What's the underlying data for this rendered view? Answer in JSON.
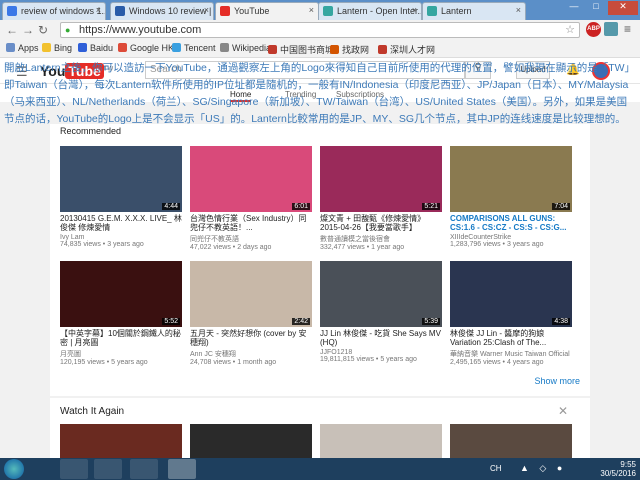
{
  "browser": {
    "tabs": [
      {
        "title": "review of windows 1...",
        "color": "#3b78e7"
      },
      {
        "title": "Windows 10 review |",
        "color": "#2a5ca8"
      },
      {
        "title": "YouTube",
        "color": "#e52d27"
      },
      {
        "title": "Lantern - Open Inter...",
        "color": "#35a6a0"
      },
      {
        "title": "Lantern",
        "color": "#35a6a0"
      }
    ],
    "url": "https://www.youtube.com",
    "abp_label": "ABP",
    "bookmarks": [
      {
        "label": "Apps",
        "color": "#6a8ec8"
      },
      {
        "label": "Bing",
        "color": "#f2c12e"
      },
      {
        "label": "Baidu",
        "color": "#2f5fd8"
      },
      {
        "label": "Google HK",
        "color": "#dd4b39"
      },
      {
        "label": "Tencent",
        "color": "#3aa0e0"
      },
      {
        "label": "Wikipedia",
        "color": "#888888"
      },
      {
        "label": "中国图书商城",
        "color": "#c0392b"
      },
      {
        "label": "找政网",
        "color": "#d35400"
      },
      {
        "label": "深圳人才网",
        "color": "#c0392b"
      }
    ]
  },
  "youtube": {
    "logo_left": "You",
    "logo_right": "Tube",
    "logo_region": "TW",
    "search_placeholder": "Search",
    "upload_label": "Upload",
    "nav": [
      "Home",
      "Trending",
      "Subscriptions"
    ],
    "section_title": "Recommended",
    "show_more": "Show more",
    "watch_it_again": "Watch It Again",
    "videos": [
      {
        "title": "20130415 G.E.M. X.X.X. LIVE_ 林俊傑 修煉愛情",
        "channel": "Ivy Lam",
        "views": "74,835 views",
        "age": "3 years ago",
        "duration": "4:44",
        "bg": "#3a4f6a",
        "linked": false
      },
      {
        "title": "台灣色情行業（Sex Industry）同兜仔不教英語！...",
        "channel": "同兜仔不教英語",
        "views": "47,022 views",
        "age": "2 days ago",
        "duration": "6:01",
        "bg": "#d94a7a",
        "linked": false
      },
      {
        "title": "燦文青 + 田馥甄《修煉愛情》2015-04-26【我要當歌手】",
        "channel": "數普通讀模之當後宿會",
        "views": "332,477 views",
        "age": "1 year ago",
        "duration": "5:21",
        "bg": "#9a2a5a",
        "linked": false
      },
      {
        "title": "COMPARISONS ALL GUNS: CS:1.6 - CS:CZ - CS:S - CS:G...",
        "channel": "XIIIdeCounterStrike",
        "views": "1,283,796 views",
        "age": "3 years ago",
        "duration": "7:04",
        "bg": "#8a7a50",
        "linked": true
      },
      {
        "title": "【中英字幕】10個關於鋼鐵人的秘密 | 月亮圖",
        "channel": "月亮圖",
        "views": "120,195 views",
        "age": "5 years ago",
        "duration": "5:52",
        "bg": "#3a1010",
        "linked": false
      },
      {
        "title": "五月天 - 突然好想你 (cover by 安穗翔)",
        "channel": "Ann JC 安穗翔",
        "views": "24,708 views",
        "age": "1 month ago",
        "duration": "2:42",
        "bg": "#c8b8a8",
        "linked": false
      },
      {
        "title": "JJ Lin 林俊傑 - 吃貨 She Says MV (HQ)",
        "channel": "JJFO1218",
        "views": "19,811,815 views",
        "age": "5 years ago",
        "duration": "5:39",
        "bg": "#4a5058",
        "linked": false
      },
      {
        "title": "林俊傑 JJ Lin - 醬摩的狗娘 Variation 25:Clash of The...",
        "channel": "華納音樂 Warner Music Taiwan Official",
        "views": "2,495,165 views",
        "age": "4 years ago",
        "duration": "4:38",
        "bg": "#2a3550",
        "linked": false
      }
    ]
  },
  "overlay_text": "開啟Lantern之後，你可以造訪一下YouTube，通過觀察左上角的Logo來得知自己目前所使用的代理的位置，譬如我現在顯示的是「TW」即Taiwan（台灣），每次Lantern软件所使用的IP位址都是隨机的，一般有IN/Indonesia（印度尼西亚）、JP/Japan（日本）、MY/Malaysia（马来西亚）、NL/Netherlands（荷兰）、SG/Singapore（新加坡）、TW/Taiwan（台湾）、US/United States（美国）。另外，如果是美国节点的话，YouTube的Logo上是不会显示「US」的。Lantern比較常用的是JP、MY、SG几个节点，其中JP的连线速度是比较理想的。",
  "taskbar": {
    "lang": "CH",
    "time": "9:55",
    "date": "30/5/2016"
  }
}
